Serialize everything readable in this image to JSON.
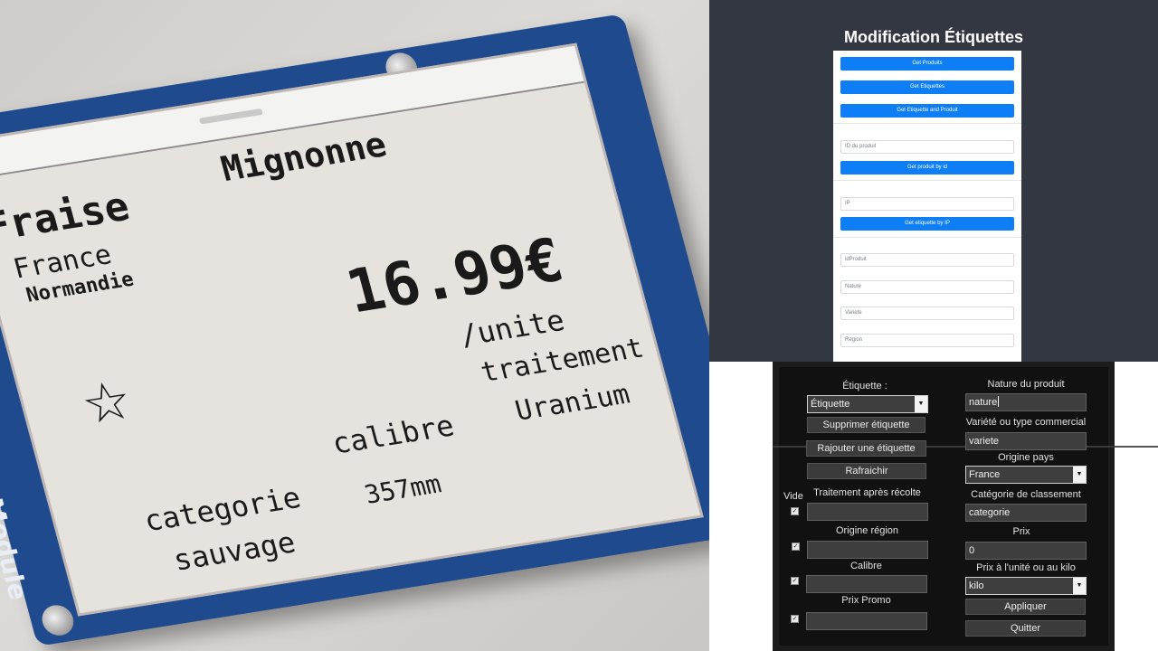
{
  "photo": {
    "board_label": "Module",
    "label": {
      "name": "Fraise",
      "variety": "Mignonne",
      "country": "France",
      "region": "Normandie",
      "price": "16.99€",
      "unit": "/unite",
      "star": "☆",
      "treatment_label": "traitement",
      "treatment_value": "Uranium",
      "size_label": "calibre",
      "size_value": "357mm",
      "category_label": "categorie",
      "category_value": "sauvage"
    }
  },
  "web": {
    "title": "Modification Étiquettes",
    "buttons": {
      "get_produits": "Get Produits",
      "get_etiquettes": "Get Etiquettes",
      "get_etiquette_produit": "Get Etiquette and Produit",
      "get_produit_by_id": "Get produit by id",
      "get_etiquette_by_ip": "Get etiquette by IP"
    },
    "placeholders": {
      "id_produit": "ID du produit",
      "ip": "IP",
      "idproduit": "idProduit",
      "nature": "Nature",
      "variete": "Variete",
      "region": "Region"
    }
  },
  "app": {
    "etiquette_label": "Étiquette :",
    "etiquette_select": "Étiquette",
    "buttons": {
      "supprimer": "Supprimer étiquette",
      "rajouter": "Rajouter une étiquette",
      "rafraichir": "Rafraichir",
      "appliquer": "Appliquer",
      "quitter": "Quitter"
    },
    "vide_label": "Vide",
    "left_fields": {
      "traitement": "Traitement après récolte",
      "origine_region": "Origine région",
      "calibre": "Calibre",
      "prix_promo": "Prix Promo"
    },
    "right_fields": {
      "nature_label": "Nature du produit",
      "nature_value": "nature",
      "variete_label": "Variété ou type commercial",
      "variete_value": "variete",
      "origine_pays_label": "Origine pays",
      "origine_pays_value": "France",
      "categorie_label": "Catégorie de classement",
      "categorie_value": "categorie",
      "prix_label": "Prix",
      "prix_value": "0",
      "prix_unite_label": "Prix à l'unité ou au kilo",
      "prix_unite_value": "kilo"
    },
    "checkmark": "✓",
    "dropdown_arrow": "▼"
  }
}
